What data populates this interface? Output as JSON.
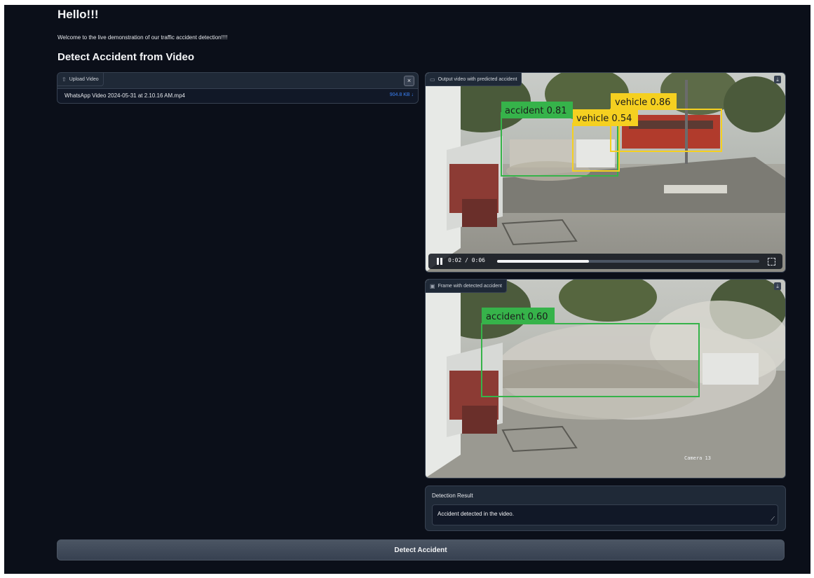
{
  "page": {
    "title": "Hello!!!",
    "welcome": "Welcome to the live demonstration of our traffic accident detection!!!!",
    "section_title": "Detect Accident from Video"
  },
  "upload": {
    "label": "Upload Video",
    "file_name": "WhatsApp Video 2024-05-31 at 2.10.16 AM.mp4",
    "file_size": "904.8 KB ↓"
  },
  "output_video": {
    "label": "Output video with predicted accident",
    "time": "0:02 / 0:06",
    "progress": 0.35,
    "detections": [
      {
        "label": "accident 0.81",
        "kind": "accident"
      },
      {
        "label": "vehicle 0.54",
        "kind": "vehicle"
      },
      {
        "label": "vehicle 0.86",
        "kind": "vehicle"
      }
    ]
  },
  "frame": {
    "label": "Frame with detected accident",
    "detections": [
      {
        "label": "accident 0.60",
        "kind": "accident"
      }
    ],
    "camera_text": "Camera 13"
  },
  "result": {
    "label": "Detection Result",
    "text": "Accident detected in the video."
  },
  "detect_button": "Detect Accident",
  "colors": {
    "accident": "#36b34a",
    "vehicle": "#f5d020",
    "background": "#0b0f19",
    "panel": "#1f2937"
  }
}
